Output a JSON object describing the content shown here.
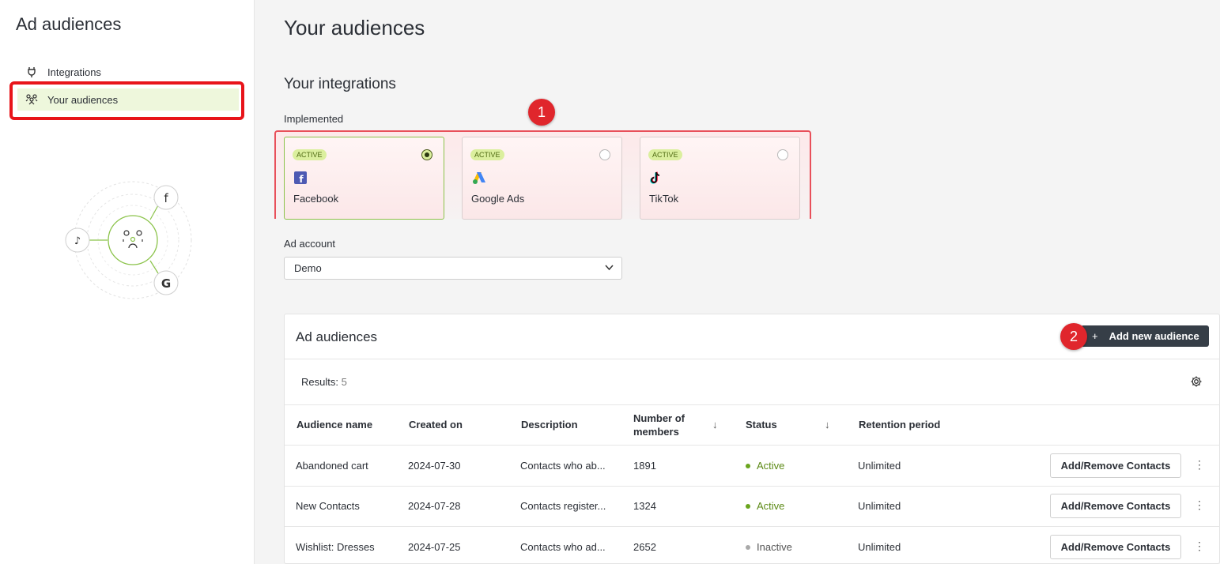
{
  "sidebar": {
    "title": "Ad audiences",
    "items": [
      {
        "label": "Integrations",
        "icon": "plug-icon"
      },
      {
        "label": "Your audiences",
        "icon": "audience-icon",
        "active": true
      }
    ]
  },
  "main": {
    "title": "Your audiences",
    "integrations_title": "Your integrations",
    "implemented_label": "Implemented",
    "markers": [
      "1",
      "2"
    ],
    "cards": [
      {
        "badge": "ACTIVE",
        "name": "Facebook",
        "selected": true,
        "icon": "facebook-icon"
      },
      {
        "badge": "ACTIVE",
        "name": "Google Ads",
        "selected": false,
        "icon": "google-ads-icon"
      },
      {
        "badge": "ACTIVE",
        "name": "TikTok",
        "selected": false,
        "icon": "tiktok-icon"
      }
    ],
    "ad_account_label": "Ad account",
    "ad_account_value": "Demo"
  },
  "panel": {
    "title": "Ad audiences",
    "add_button": "Add new audience",
    "results_label": "Results:",
    "results_count": "5",
    "columns": {
      "name": "Audience name",
      "created": "Created on",
      "description": "Description",
      "members_line1": "Number of",
      "members_line2": "members",
      "status": "Status",
      "retention": "Retention period"
    },
    "rows": [
      {
        "name": "Abandoned cart",
        "created": "2024-07-30",
        "description": "Contacts who ab...",
        "members": "1891",
        "status": "Active",
        "retention": "Unlimited",
        "action": "Add/Remove Contacts"
      },
      {
        "name": "New Contacts",
        "created": "2024-07-28",
        "description": "Contacts register...",
        "members": "1324",
        "status": "Active",
        "retention": "Unlimited",
        "action": "Add/Remove Contacts"
      },
      {
        "name": "Wishlist: Dresses",
        "created": "2024-07-25",
        "description": "Contacts who ad...",
        "members": "2652",
        "status": "Inactive",
        "retention": "Unlimited",
        "action": "Add/Remove Contacts"
      }
    ]
  },
  "colors": {
    "active_green": "#5c8a16",
    "highlight_red": "#e8141a",
    "button_dark": "#363e47",
    "badge_bg": "#dbef9e"
  }
}
